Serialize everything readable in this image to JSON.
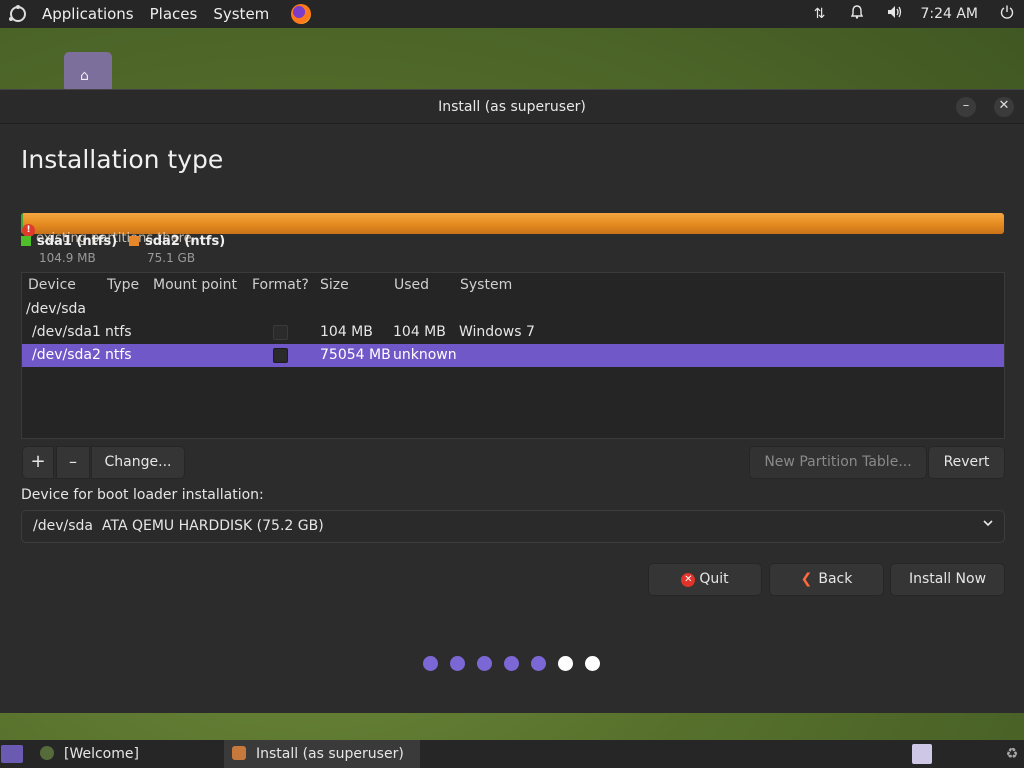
{
  "top_panel": {
    "menus": [
      "Applications",
      "Places",
      "System"
    ],
    "clock": "7:24 AM",
    "tray_icons": [
      "network-icon",
      "bell-icon",
      "volume-icon",
      "power-icon"
    ]
  },
  "window": {
    "title": "Install (as superuser)",
    "minimize_glyph": "–",
    "close_glyph": "✕"
  },
  "page": {
    "title": "Installation type",
    "warning_text": "existing partitions there.",
    "warning_glyph": "!"
  },
  "colors": {
    "accent": "#7158c8",
    "sda1": "#4fbf2a",
    "sda2": "#e8872a",
    "dot_active": "#7c68d4",
    "dot_inactive": "#ffffff"
  },
  "legend": [
    {
      "name": "sda1 (ntfs)",
      "size": "104.9 MB"
    },
    {
      "name": "sda2 (ntfs)",
      "size": "75.1 GB"
    }
  ],
  "table": {
    "headers": {
      "device": "Device",
      "type": "Type",
      "mount": "Mount point",
      "format": "Format?",
      "size": "Size",
      "used": "Used",
      "system": "System"
    },
    "disk": "/dev/sda",
    "rows": [
      {
        "device": "/dev/sda1",
        "type": "ntfs",
        "size": "104 MB",
        "used": "104 MB",
        "system": "Windows 7",
        "format": false,
        "selected": false
      },
      {
        "device": "/dev/sda2",
        "type": "ntfs",
        "size": "75054 MB",
        "used": "unknown",
        "system": "",
        "format": false,
        "selected": true
      }
    ]
  },
  "toolbar": {
    "add": "+",
    "remove": "–",
    "change": "Change...",
    "new_table": "New Partition Table...",
    "revert": "Revert"
  },
  "boot_loader": {
    "label": "Device for boot loader installation:",
    "device": "/dev/sda",
    "description": "ATA QEMU HARDDISK (75.2 GB)"
  },
  "actions": {
    "quit": "Quit",
    "back": "Back",
    "install": "Install Now"
  },
  "progress": {
    "total_steps": 7,
    "completed_steps": 5
  },
  "taskbar": {
    "tasks": [
      "[Welcome]",
      "Install (as superuser)"
    ]
  }
}
